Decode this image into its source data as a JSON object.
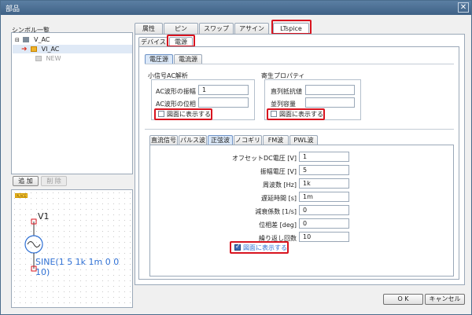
{
  "window": {
    "title": "部品",
    "close_glyph": "✕"
  },
  "left": {
    "symbol_list_label": "シンボル一覧",
    "tree": [
      {
        "label": "V_AC"
      },
      {
        "label": "VI_AC"
      },
      {
        "label": "NEW"
      }
    ],
    "add_button": "追 加",
    "delete_button": "削 除",
    "preview": {
      "tag": "PLACE",
      "symbol_name": "V1",
      "symbol_value": "SINE(1 5 1k 1m 0 0 10)"
    }
  },
  "tabs": [
    "属性",
    "ピン",
    "スワップ",
    "アサイン",
    "LTspice"
  ],
  "subtabs": [
    "デバイス",
    "電源"
  ],
  "source_tabs": [
    "電圧源",
    "電流源"
  ],
  "small_signal": {
    "title": "小信号AC解析",
    "amplitude_label": "AC波形の振幅",
    "amplitude_value": "1",
    "phase_label": "AC波形の位相",
    "phase_value": "",
    "show_label": "図面に表示する",
    "show_checked": false
  },
  "parasitic": {
    "title": "寄生プロパティ",
    "series_r_label": "直列抵抗値",
    "series_r_value": "",
    "parallel_c_label": "並列容量",
    "parallel_c_value": "",
    "show_label": "図面に表示する",
    "show_checked": false
  },
  "wave_tabs": [
    "直流信号",
    "パルス波",
    "正弦波",
    "ノコギリ波",
    "FM波",
    "PWL波"
  ],
  "sine": {
    "fields": [
      {
        "label": "オフセットDC電圧 [V]",
        "value": "1"
      },
      {
        "label": "振幅電圧 [V]",
        "value": "5"
      },
      {
        "label": "周波数 [Hz]",
        "value": "1k"
      },
      {
        "label": "遅延時間 [s]",
        "value": "1m"
      },
      {
        "label": "減衰係数 [1/s]",
        "value": "0"
      },
      {
        "label": "位相差 [deg]",
        "value": "0"
      },
      {
        "label": "繰り返し回数",
        "value": "10"
      }
    ],
    "show_label": "図面に表示する",
    "show_checked": true
  },
  "ok_button": "O K",
  "cancel_button": "キャンセル",
  "colors": {
    "highlight": "#d8141f",
    "arrow": "#e0301e",
    "accent": "#2f70d4"
  }
}
